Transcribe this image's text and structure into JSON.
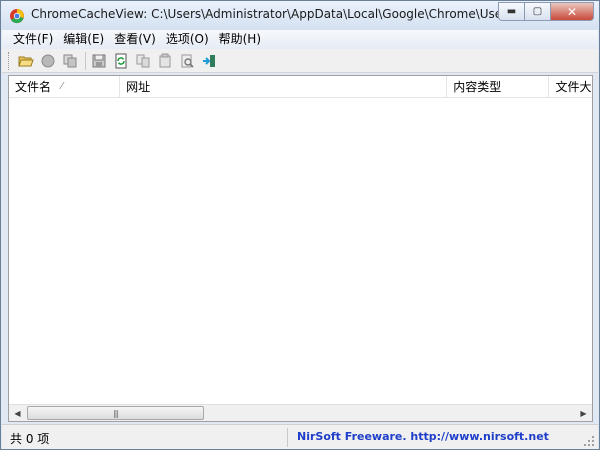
{
  "window": {
    "title": "ChromeCacheView:  C:\\Users\\Administrator\\AppData\\Local\\Google\\Chrome\\User D..."
  },
  "menu": [
    "文件(F)",
    "编辑(E)",
    "查看(V)",
    "选项(O)",
    "帮助(H)"
  ],
  "toolbar": [
    "open-folder-icon",
    "stop-icon",
    "copy-files-icon",
    "save-icon",
    "refresh-icon",
    "copy-icon",
    "properties-icon",
    "find-icon",
    "exit-icon"
  ],
  "columns": [
    "文件名",
    "网址",
    "内容类型",
    "文件大"
  ],
  "status": {
    "count": "共 0 项",
    "link": "NirSoft Freeware.  http://www.nirsoft.net"
  },
  "scroll": {
    "thumb_glyph": "|||"
  },
  "caption": {
    "min": "▬",
    "max": "▢",
    "close": "✕"
  }
}
